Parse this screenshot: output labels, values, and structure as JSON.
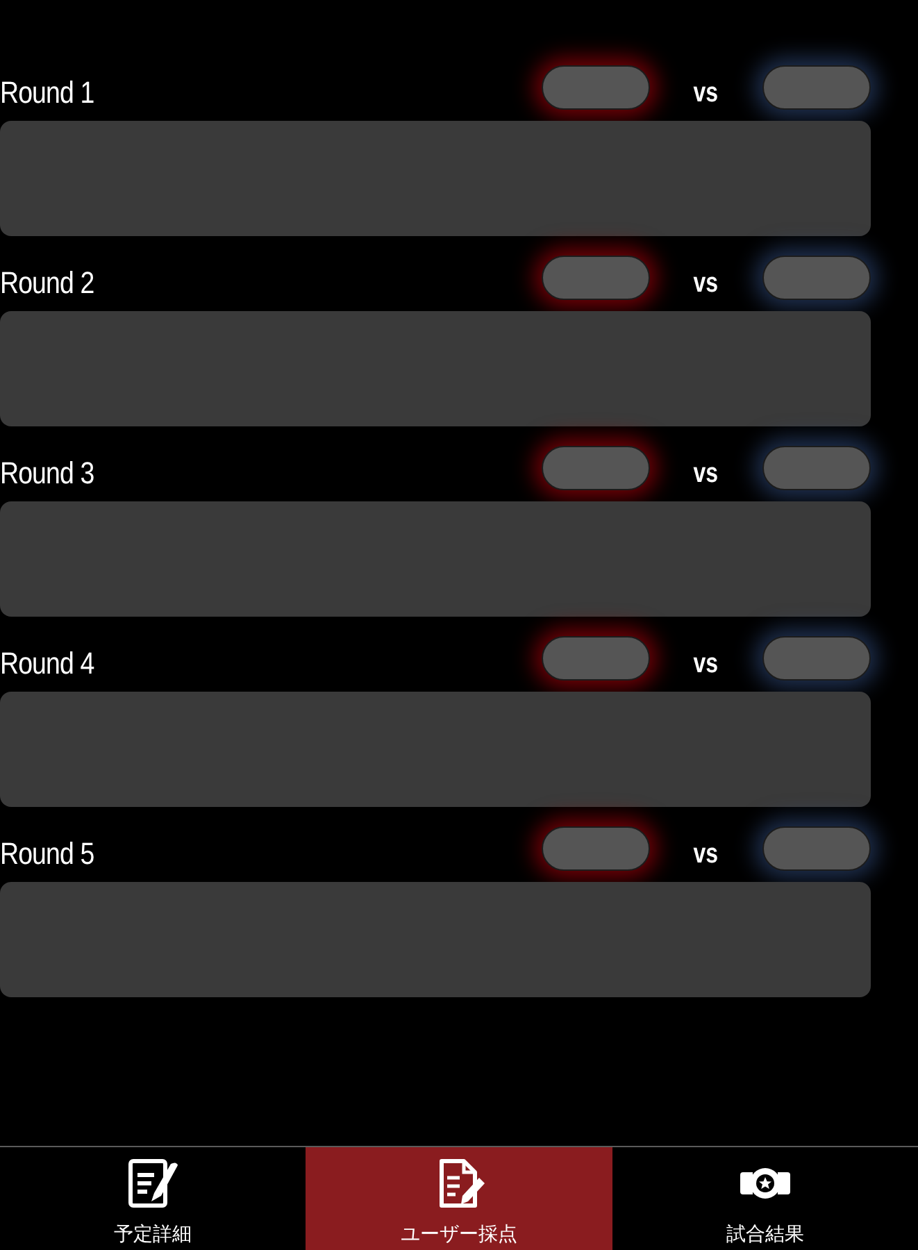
{
  "rounds": [
    {
      "label": "Round 1",
      "vs": "vs"
    },
    {
      "label": "Round 2",
      "vs": "vs"
    },
    {
      "label": "Round 3",
      "vs": "vs"
    },
    {
      "label": "Round 4",
      "vs": "vs"
    },
    {
      "label": "Round 5",
      "vs": "vs"
    }
  ],
  "tab_bar": {
    "tabs": [
      {
        "label": "予定詳細",
        "selected": false
      },
      {
        "label": "ユーザー採点",
        "selected": true
      },
      {
        "label": "試合結果",
        "selected": false
      }
    ]
  }
}
